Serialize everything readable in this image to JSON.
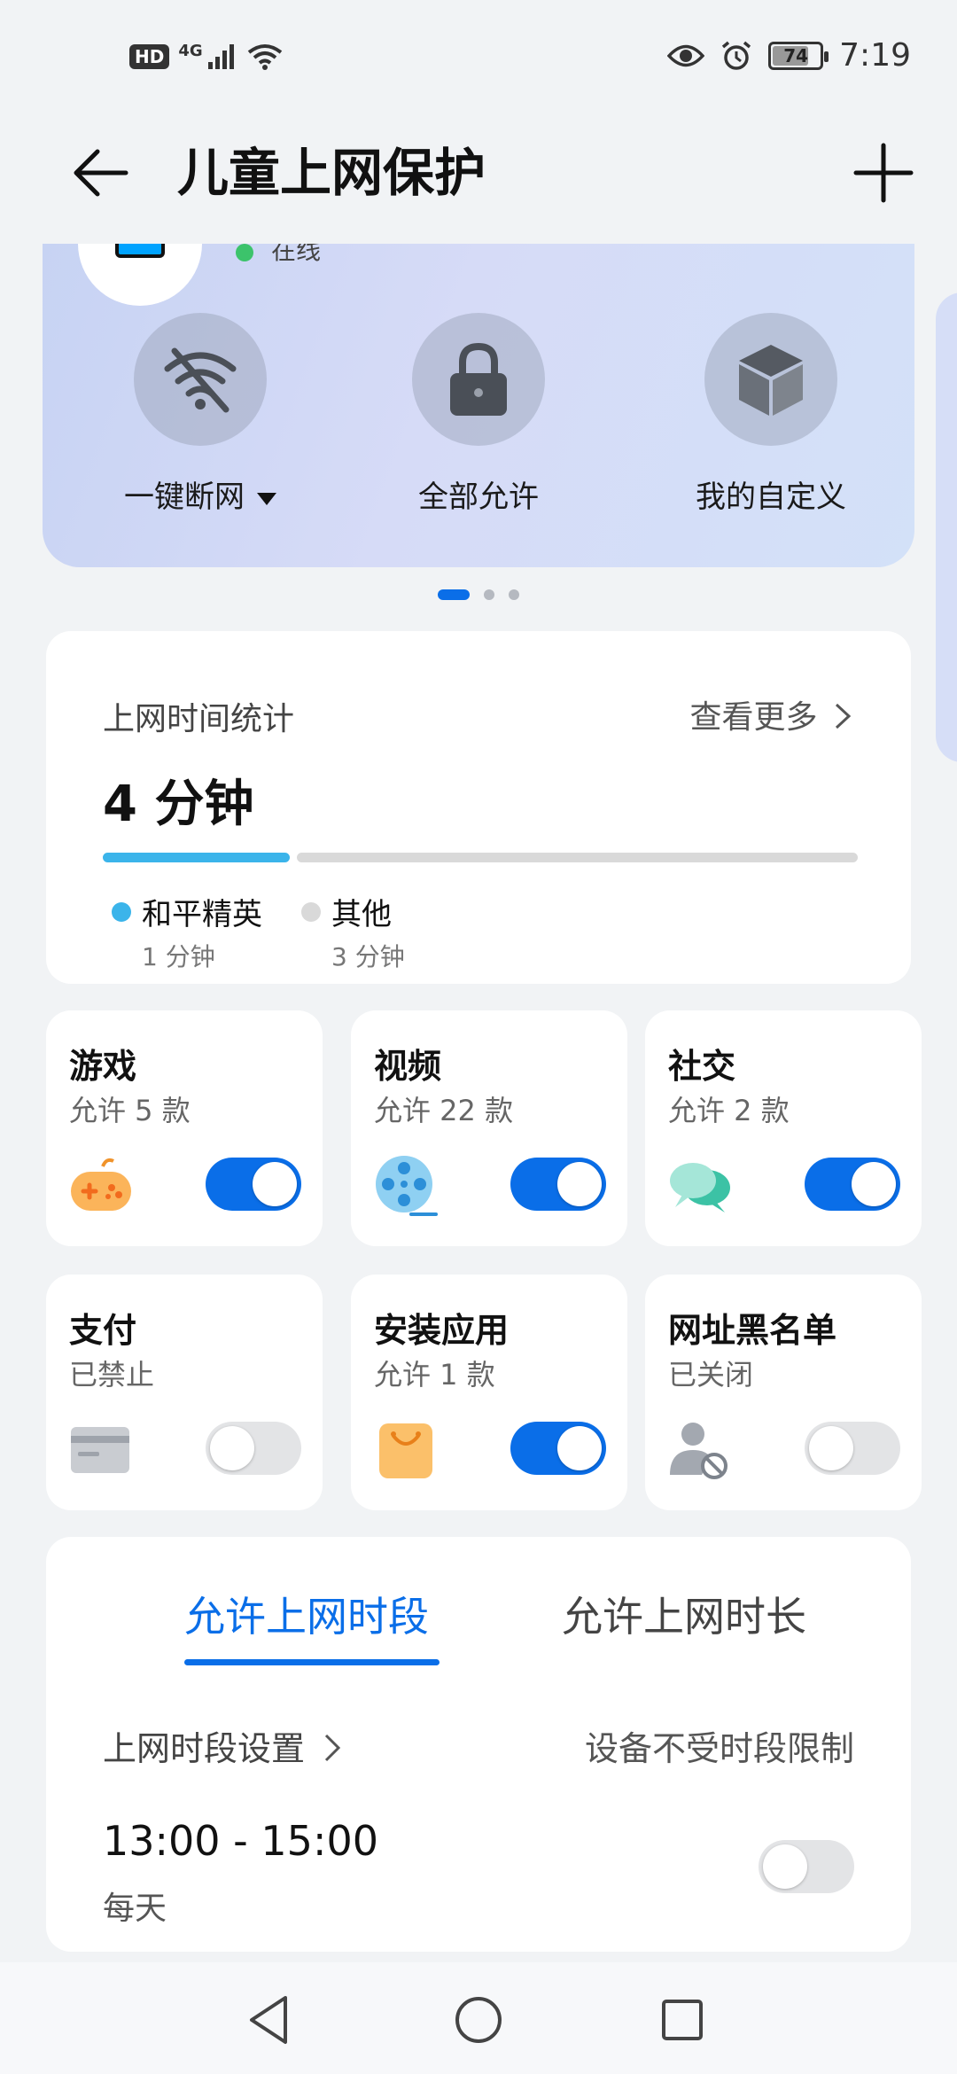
{
  "status_bar": {
    "network_left": "HD",
    "network_type": "4G",
    "battery": "74",
    "time": "7:19"
  },
  "header": {
    "title": "儿童上网保护"
  },
  "hero": {
    "status_text": "在线",
    "actions": [
      {
        "label": "一键断网",
        "icon": "wifi-off-icon",
        "has_dropdown": true
      },
      {
        "label": "全部允许",
        "icon": "lock-icon"
      },
      {
        "label": "我的自定义",
        "icon": "cube-icon"
      }
    ],
    "page_indicator": {
      "count": 3,
      "active": 1
    }
  },
  "stats": {
    "title": "上网时间统计",
    "more": "查看更多",
    "total": "4 分钟",
    "items": [
      {
        "name": "和平精英",
        "duration": "1 分钟",
        "fraction": 0.25,
        "color": "#3bb4ea"
      },
      {
        "name": "其他",
        "duration": "3 分钟",
        "fraction": 0.75,
        "color": "#d9d9d9"
      }
    ]
  },
  "tiles": [
    {
      "title": "游戏",
      "subtitle": "允许 5 款",
      "icon": "gamepad-icon",
      "enabled": true
    },
    {
      "title": "视频",
      "subtitle": "允许 22 款",
      "icon": "film-reel-icon",
      "enabled": true
    },
    {
      "title": "社交",
      "subtitle": "允许 2 款",
      "icon": "chat-bubbles-icon",
      "enabled": true
    },
    {
      "title": "支付",
      "subtitle": "已禁止",
      "icon": "credit-card-icon",
      "enabled": false
    },
    {
      "title": "安装应用",
      "subtitle": "允许 1 款",
      "icon": "shopping-bag-icon",
      "enabled": true
    },
    {
      "title": "网址黑名单",
      "subtitle": "已关闭",
      "icon": "user-blocked-icon",
      "enabled": false
    }
  ],
  "schedule": {
    "tabs": [
      "允许上网时段",
      "允许上网时长"
    ],
    "active_tab": 0,
    "setting_label": "上网时段设置",
    "note": "设备不受时段限制",
    "time_range": "13:00 - 15:00",
    "repeat": "每天",
    "enabled": false
  },
  "colors": {
    "accent": "#0a6ee8",
    "online": "#3cc36b"
  }
}
